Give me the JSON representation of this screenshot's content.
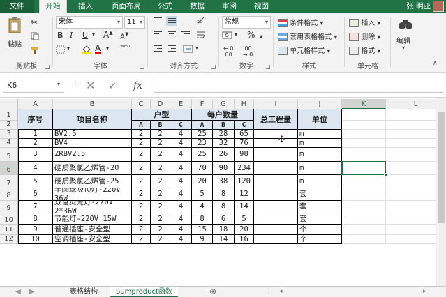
{
  "tabs": [
    "文件",
    "开始",
    "插入",
    "页面布局",
    "公式",
    "数据",
    "审阅",
    "视图"
  ],
  "active_tab": "开始",
  "user": "张 明亚",
  "ribbon": {
    "clipboard": {
      "paste": "粘贴",
      "label": "剪贴板"
    },
    "font": {
      "name": "宋体",
      "size": "11",
      "bold": "B",
      "italic": "I",
      "underline": "U",
      "grow": "A",
      "shrink": "A",
      "color_letter": "A",
      "wen": "wén",
      "label": "字体"
    },
    "align": {
      "label": "对齐方式"
    },
    "number": {
      "format": "常规",
      "percent": "%",
      "comma": ",",
      "label": "数字"
    },
    "styles": {
      "cond": "条件格式",
      "table": "套用表格格式",
      "cell": "单元格样式",
      "label": "样式"
    },
    "cells": {
      "insert": "插入",
      "delete": "删除",
      "format": "格式",
      "label": "单元格"
    },
    "edit": {
      "label": "编辑"
    }
  },
  "formula_bar": {
    "name_box": "K6",
    "fx": "fx",
    "formula": ""
  },
  "columns": [
    "A",
    "B",
    "C",
    "D",
    "E",
    "F",
    "G",
    "H",
    "I",
    "J",
    "K",
    "L"
  ],
  "selected_column": "K",
  "rows": [
    "1",
    "2",
    "3",
    "4",
    "5",
    "6",
    "7",
    "8",
    "9",
    "10",
    "11",
    "12"
  ],
  "selected_row": "6",
  "table": {
    "headers": {
      "seq": "序号",
      "name": "项目名称",
      "house_type": "户型",
      "per_house": "每户数量",
      "total": "总工程量",
      "unit": "单位"
    },
    "sub": [
      "A",
      "B",
      "C",
      "A",
      "B",
      "C"
    ],
    "data": [
      [
        "1",
        "BV2.5",
        "2",
        "2",
        "4",
        "25",
        "28",
        "65",
        "",
        "m"
      ],
      [
        "2",
        "BV4",
        "2",
        "2",
        "4",
        "23",
        "32",
        "76",
        "",
        "m"
      ],
      [
        "3",
        "ZRBV2.5",
        "2",
        "2",
        "4",
        "25",
        "26",
        "98",
        "",
        "m"
      ],
      [
        "4",
        "硬质聚氯乙烯管-20",
        "2",
        "2",
        "4",
        "70",
        "90",
        "234",
        "",
        "m"
      ],
      [
        "5",
        "硬质聚氯乙烯管-25",
        "2",
        "2",
        "4",
        "20",
        "38",
        "120",
        "",
        "m"
      ],
      [
        "6",
        "半圆球吸顶灯-220V 36W",
        "2",
        "2",
        "4",
        "5",
        "8",
        "12",
        "",
        "套"
      ],
      [
        "7",
        "双管荧光灯-220V 2*36W",
        "2",
        "2",
        "4",
        "4",
        "8",
        "14",
        "",
        "套"
      ],
      [
        "8",
        "节能灯-220V 15W",
        "2",
        "2",
        "4",
        "8",
        "6",
        "5",
        "",
        "套"
      ],
      [
        "9",
        "普通插座-安全型",
        "2",
        "2",
        "4",
        "15",
        "18",
        "20",
        "",
        "个"
      ],
      [
        "10",
        "空调插座-安全型",
        "2",
        "2",
        "4",
        "9",
        "14",
        "16",
        "",
        "个"
      ]
    ]
  },
  "sheets": [
    "表格结构",
    "Sumproduct函数"
  ],
  "active_sheet": "Sumproduct函数"
}
